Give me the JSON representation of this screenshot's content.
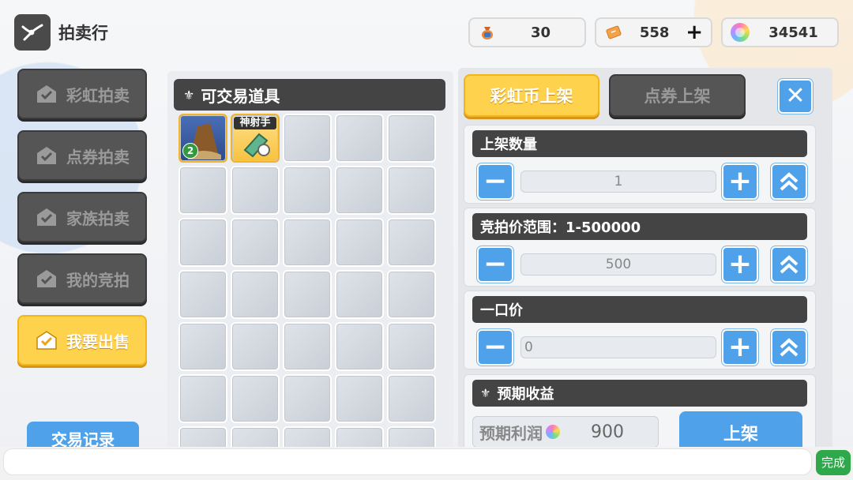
{
  "header": {
    "title": "拍卖行",
    "icon": "auction-logo-icon"
  },
  "currencies": [
    {
      "icon": "money-bag-icon",
      "value": "30",
      "has_plus": false
    },
    {
      "icon": "coupon-ticket-icon",
      "value": "558",
      "has_plus": true,
      "plus": "+"
    },
    {
      "icon": "rainbow-coin-icon",
      "value": "34541",
      "has_plus": false
    }
  ],
  "sidebar": {
    "items": [
      {
        "label": "彩虹拍卖",
        "active": false
      },
      {
        "label": "点券拍卖",
        "active": false
      },
      {
        "label": "家族拍卖",
        "active": false
      },
      {
        "label": "我的竞拍",
        "active": false
      },
      {
        "label": "我要出售",
        "active": true
      }
    ],
    "record_button": "交易记录"
  },
  "inventory": {
    "title": "可交易道具",
    "items": [
      {
        "slot": 0,
        "badge": "2",
        "kind": "rock"
      },
      {
        "slot": 1,
        "tag": "神射手",
        "kind": "cannon"
      }
    ],
    "slot_count": 35
  },
  "listing": {
    "tabs": [
      {
        "label": "彩虹币上架",
        "active": true
      },
      {
        "label": "点券上架",
        "active": false
      }
    ],
    "close_label": "✕",
    "quantity": {
      "label": "上架数量",
      "value": "1"
    },
    "bid": {
      "label": "竞拍价范围：1-500000",
      "value": "500"
    },
    "buyout": {
      "label": "一口价",
      "value": "0"
    },
    "expected": {
      "label": "预期收益",
      "profit_label": "预期利润",
      "profit_value": "900",
      "list_button": "上架"
    },
    "minus": "−",
    "plus": "+"
  },
  "footer": {
    "done_label": "完成"
  },
  "colors": {
    "accent_blue": "#4fa2ea",
    "accent_yellow": "#ffd24d",
    "dark": "#444444",
    "confirm_green": "#2ea84a"
  }
}
